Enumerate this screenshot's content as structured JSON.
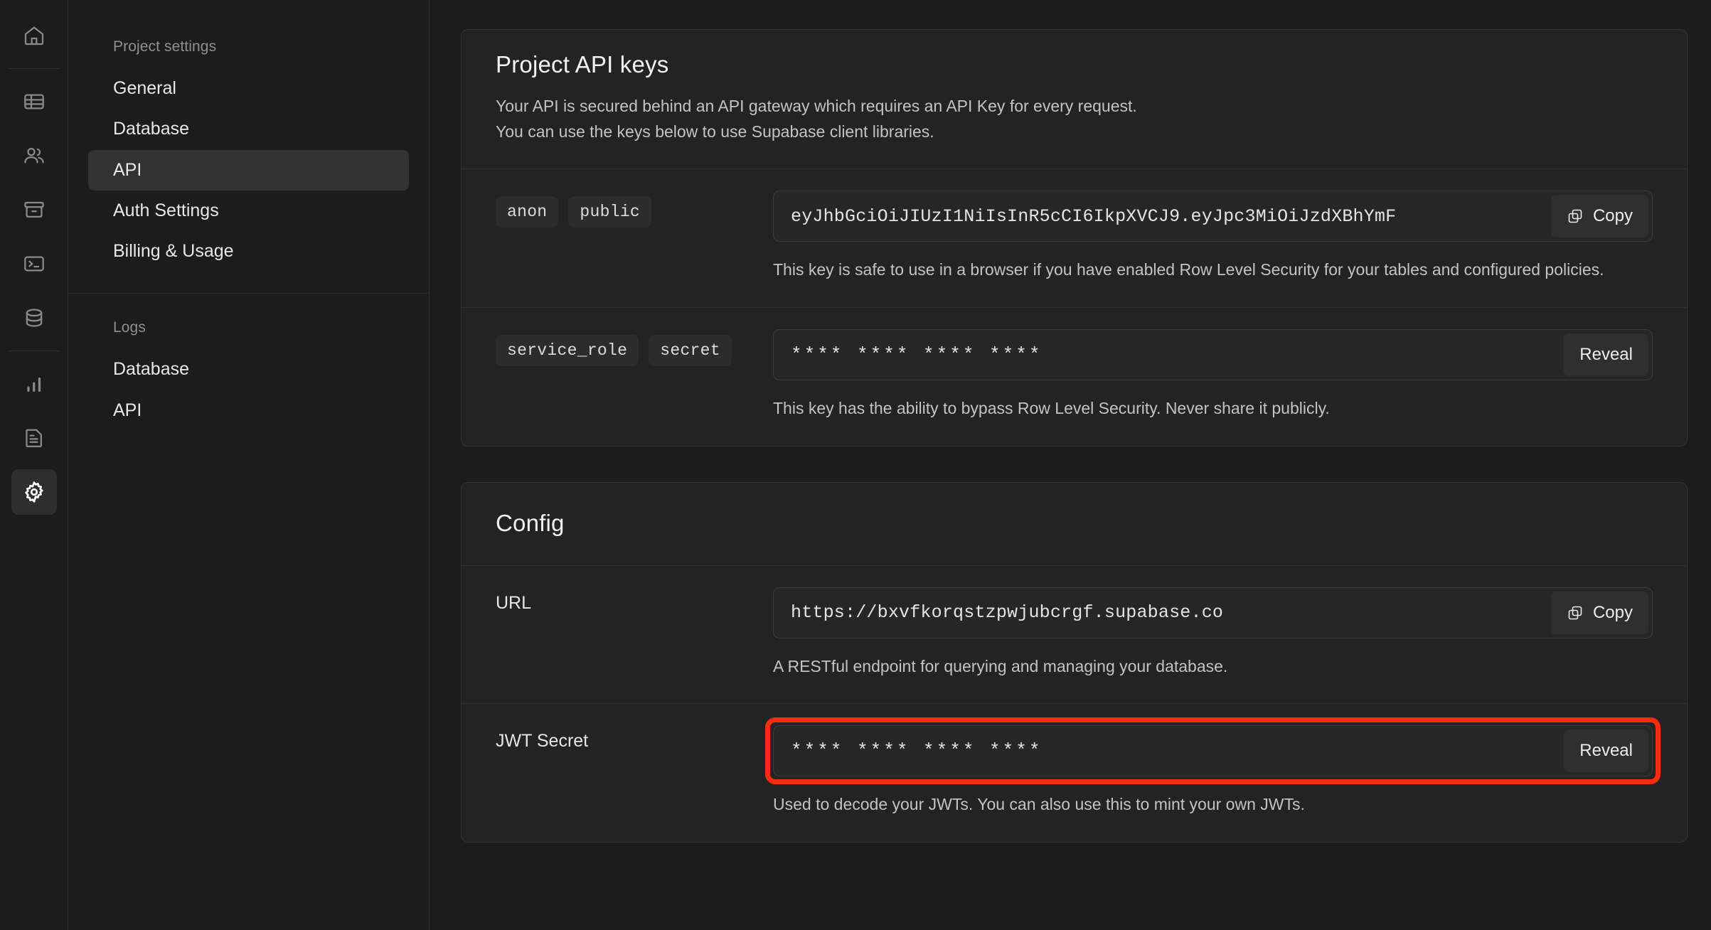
{
  "rail": {
    "items": [
      {
        "name": "home-icon",
        "label": "Home"
      },
      {
        "name": "table-editor-icon",
        "label": "Table editor"
      },
      {
        "name": "authentication-icon",
        "label": "Authentication"
      },
      {
        "name": "storage-icon",
        "label": "Storage"
      },
      {
        "name": "sql-editor-icon",
        "label": "SQL editor"
      },
      {
        "name": "database-icon",
        "label": "Database"
      },
      {
        "name": "reports-icon",
        "label": "Reports"
      },
      {
        "name": "logs-icon",
        "label": "Logs"
      },
      {
        "name": "settings-icon",
        "label": "Settings"
      }
    ],
    "active_index": 8
  },
  "nav": {
    "groups": [
      {
        "title": "Project settings",
        "items": [
          {
            "label": "General",
            "active": false
          },
          {
            "label": "Database",
            "active": false
          },
          {
            "label": "API",
            "active": true
          },
          {
            "label": "Auth Settings",
            "active": false
          },
          {
            "label": "Billing & Usage",
            "active": false
          }
        ]
      },
      {
        "title": "Logs",
        "items": [
          {
            "label": "Database",
            "active": false
          },
          {
            "label": "API",
            "active": false
          }
        ]
      }
    ]
  },
  "api_keys_card": {
    "title": "Project API keys",
    "description_line1": "Your API is secured behind an API gateway which requires an API Key for every request.",
    "description_line2": "You can use the keys below to use Supabase client libraries.",
    "rows": [
      {
        "badges": [
          "anon",
          "public"
        ],
        "value": "eyJhbGciOiJIUzI1NiIsInR5cCI6IkpXVCJ9.eyJpc3MiOiJzdXBhYmF",
        "button_label": "Copy",
        "button_icon": "copy-icon",
        "note": "This key is safe to use in a browser if you have enabled Row Level Security for your tables and configured policies."
      },
      {
        "badges": [
          "service_role",
          "secret"
        ],
        "value": "**** **** **** ****",
        "button_label": "Reveal",
        "button_icon": null,
        "note": "This key has the ability to bypass Row Level Security. Never share it publicly."
      }
    ]
  },
  "config_card": {
    "title": "Config",
    "rows": [
      {
        "label": "URL",
        "value": "https://bxvfkorqstzpwjubcrgf.supabase.co",
        "button_label": "Copy",
        "button_icon": "copy-icon",
        "note": "A RESTful endpoint for querying and managing your database.",
        "highlighted": false
      },
      {
        "label": "JWT Secret",
        "value": "**** **** **** ****",
        "button_label": "Reveal",
        "button_icon": null,
        "note": "Used to decode your JWTs. You can also use this to mint your own JWTs.",
        "highlighted": true
      }
    ]
  },
  "colors": {
    "page_background": "#1c1c1c",
    "card_background": "#232323",
    "card_border": "#333333",
    "accent_highlight": "#FB2B12",
    "text_primary": "#f2f2f2",
    "text_secondary": "#c3c3c3",
    "nav_active_background": "#323232"
  }
}
